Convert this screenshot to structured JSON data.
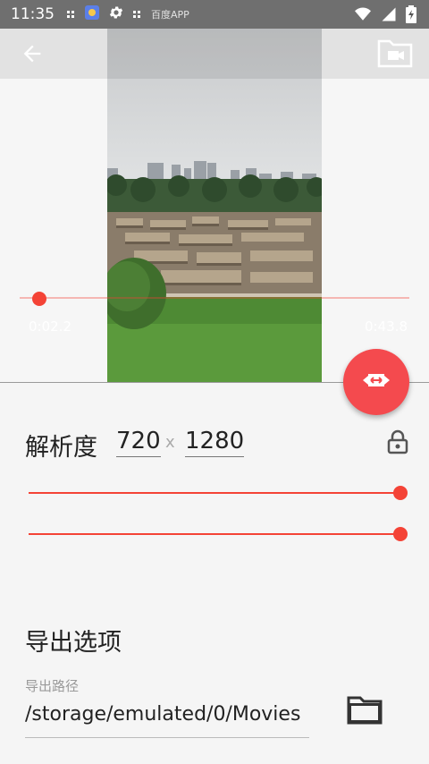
{
  "status_bar": {
    "time": "11:35",
    "notif_text": "百度APP",
    "icons": [
      "notification-dots-icon",
      "baidu-app-icon",
      "settings-icon",
      "notification-dots-icon"
    ],
    "right_icons": [
      "wifi-icon",
      "signal-icon",
      "battery-charging-icon"
    ]
  },
  "toolbar": {
    "back_icon": "arrow-left-icon",
    "folder_icon": "video-folder-icon"
  },
  "timeline": {
    "start_time": "0:02.2",
    "end_time": "0:43.8",
    "position_fraction": 0.05
  },
  "fab": {
    "icon": "video-trim-icon"
  },
  "resolution": {
    "label": "解析度",
    "width": "720",
    "separator": "x",
    "height": "1280",
    "lock_icon": "lock-icon",
    "slider1_fraction": 1.0,
    "slider2_fraction": 1.0
  },
  "export": {
    "title": "导出选项",
    "path_label": "导出路径",
    "path_value": "/storage/emulated/0/Movies",
    "folder_icon": "folder-icon"
  },
  "colors": {
    "accent": "#f44336",
    "fab": "#f44a4e",
    "text": "#222222",
    "muted": "#9a9a9a"
  }
}
